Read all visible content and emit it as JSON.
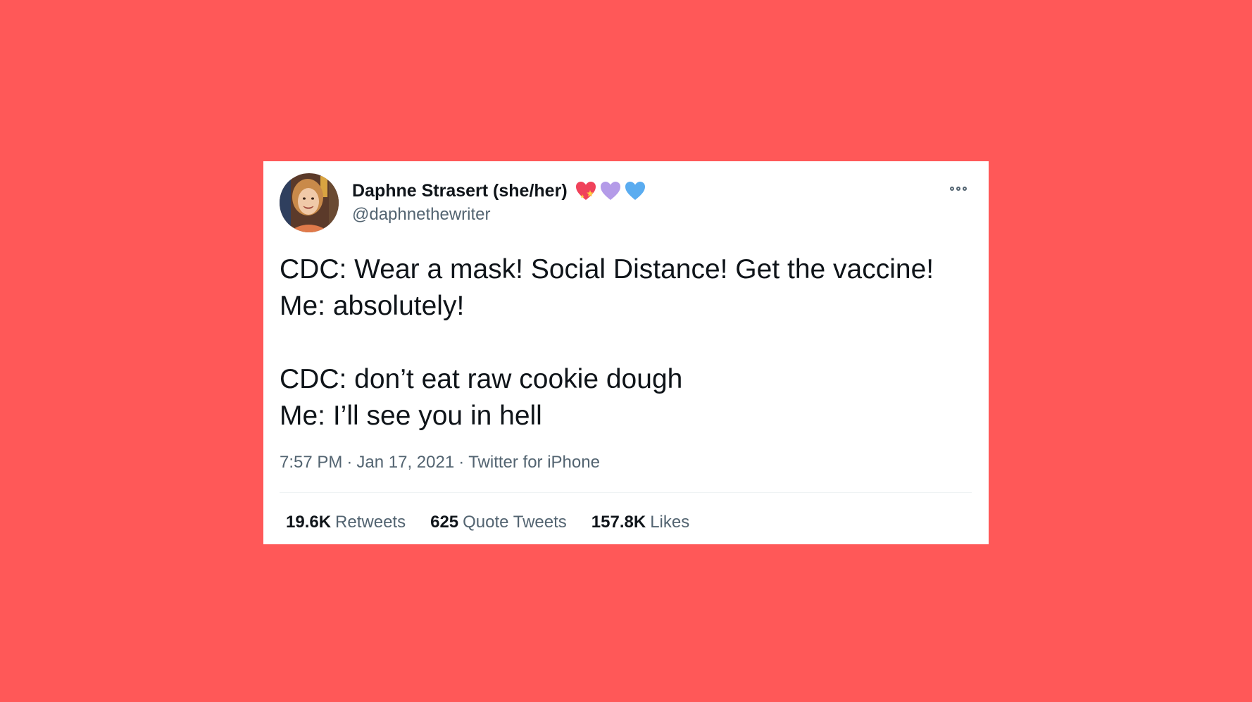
{
  "tweet": {
    "author": {
      "name": "Daphne Strasert (she/her)",
      "handle": "@daphnethewriter",
      "emoji": [
        "heart-sparkle-icon",
        "purple-heart-icon",
        "blue-heart-icon"
      ]
    },
    "text_lines": [
      "CDC: Wear a mask! Social Distance! Get the vaccine!",
      "Me: absolutely!",
      "",
      "CDC: don’t eat raw cookie dough",
      "Me: I’ll see you in hell"
    ],
    "time": "7:57 PM",
    "date": "Jan 17, 2021",
    "source": "Twitter for iPhone",
    "separator": "·",
    "stats": {
      "retweets": {
        "count": "19.6K",
        "label": "Retweets"
      },
      "quote_tweets": {
        "count": "625",
        "label": "Quote Tweets"
      },
      "likes": {
        "count": "157.8K",
        "label": "Likes"
      }
    }
  },
  "colors": {
    "background": "#ff5858",
    "card": "#ffffff",
    "text_primary": "#0f1419",
    "text_secondary": "#536471",
    "heart_red": "#f0425a",
    "heart_purple": "#b49be8",
    "heart_blue": "#5aacf0"
  }
}
